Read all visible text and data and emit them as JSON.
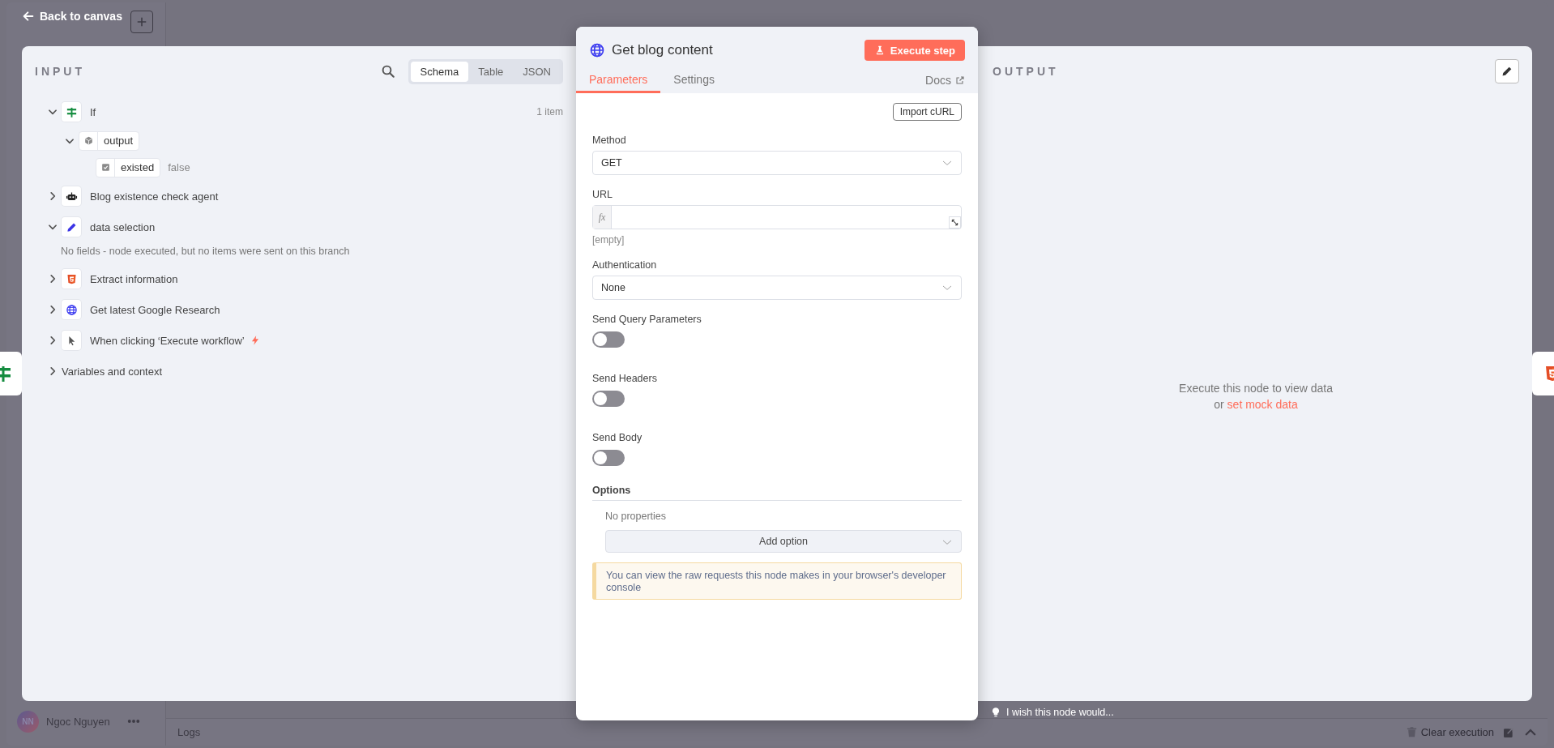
{
  "header": {
    "back_label": "Back to canvas"
  },
  "sidebar": {
    "user": {
      "initials": "NN",
      "name": "Ngoc Nguyen"
    }
  },
  "logs_bar": {
    "title": "Logs",
    "clear_label": "Clear execution"
  },
  "input_panel": {
    "title": "INPUT",
    "view_tabs": [
      {
        "label": "Schema",
        "selected": true
      },
      {
        "label": "Table",
        "selected": false
      },
      {
        "label": "JSON",
        "selected": false
      }
    ],
    "tree": [
      {
        "kind": "if",
        "label": "If",
        "count": "1 item",
        "expanded": true,
        "children": [
          {
            "kind": "object",
            "label": "output",
            "expanded": true,
            "children": [
              {
                "kind": "boolean",
                "label": "existed",
                "value": "false"
              }
            ]
          }
        ]
      },
      {
        "kind": "agent",
        "label": "Blog existence check agent",
        "expanded": false
      },
      {
        "kind": "edit",
        "label": "data selection",
        "expanded": true,
        "note": "No fields - node executed, but no items were sent on this branch"
      },
      {
        "kind": "html",
        "label": "Extract information",
        "expanded": false
      },
      {
        "kind": "http",
        "label": "Get latest Google Research",
        "expanded": false
      },
      {
        "kind": "trigger",
        "label": "When clicking ‘Execute workflow’",
        "expanded": false
      },
      {
        "kind": "section",
        "label": "Variables and context",
        "expanded": false
      }
    ]
  },
  "node_panel": {
    "title": "Get blog content",
    "execute_label": "Execute step",
    "tabs": [
      {
        "label": "Parameters",
        "selected": true
      },
      {
        "label": "Settings",
        "selected": false
      }
    ],
    "docs_label": "Docs",
    "import_label": "Import cURL",
    "fields": [
      {
        "kind": "select",
        "label": "Method",
        "value": "GET"
      },
      {
        "kind": "expression",
        "label": "URL",
        "fx": "fx",
        "hint": "[empty]"
      },
      {
        "kind": "select",
        "label": "Authentication",
        "value": "None"
      },
      {
        "kind": "toggle",
        "label": "Send Query Parameters",
        "on": false
      },
      {
        "kind": "toggle",
        "label": "Send Headers",
        "on": false
      },
      {
        "kind": "toggle",
        "label": "Send Body",
        "on": false
      }
    ],
    "options": {
      "title": "Options",
      "empty_text": "No properties",
      "add_label": "Add option"
    },
    "notice": "You can view the raw requests this node makes in your browser's developer console"
  },
  "output_panel": {
    "title": "OUTPUT",
    "empty_text": "Execute this node to view data",
    "or_text": "or",
    "mock_link": "set mock data"
  },
  "feedback": {
    "label": "I wish this node would..."
  }
}
